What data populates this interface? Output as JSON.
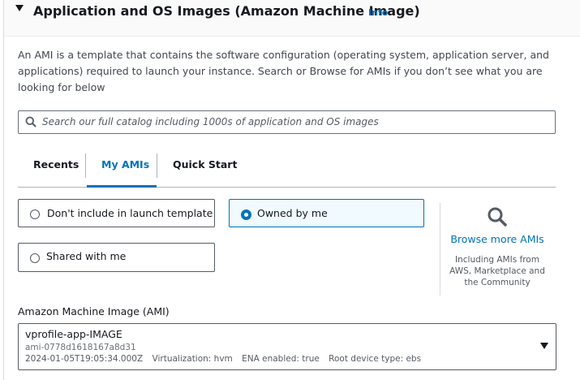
{
  "section": {
    "title": "Application and OS Images (Amazon Machine Image)",
    "info_label": "Info",
    "description": "An AMI is a template that contains the software configuration (operating system, application server, and applications) required to launch your instance. Search or Browse for AMIs if you don’t see what you are looking for below"
  },
  "search": {
    "placeholder": "Search our full catalog including 1000s of application and OS images"
  },
  "tabs": [
    {
      "label": "Recents",
      "active": false
    },
    {
      "label": "My AMIs",
      "active": true
    },
    {
      "label": "Quick Start",
      "active": false
    }
  ],
  "ownership_options": [
    {
      "label": "Don't include in launch template",
      "selected": false
    },
    {
      "label": "Owned by me",
      "selected": true
    },
    {
      "label": "Shared with me",
      "selected": false
    }
  ],
  "browse": {
    "link_label": "Browse more AMIs",
    "subtext": "Including AMIs from AWS, Marketplace and the Community"
  },
  "ami": {
    "field_label": "Amazon Machine Image (AMI)",
    "name": "vprofile-app-IMAGE",
    "id": "ami-0778d1618167a8d31",
    "created": "2024-01-05T19:05:34.000Z",
    "virtualization": "Virtualization: hvm",
    "ena": "ENA enabled: true",
    "root_device": "Root device type: ebs"
  },
  "colors": {
    "accent": "#0073bb",
    "selected_bg": "#f1faff",
    "text": "#16191f"
  }
}
